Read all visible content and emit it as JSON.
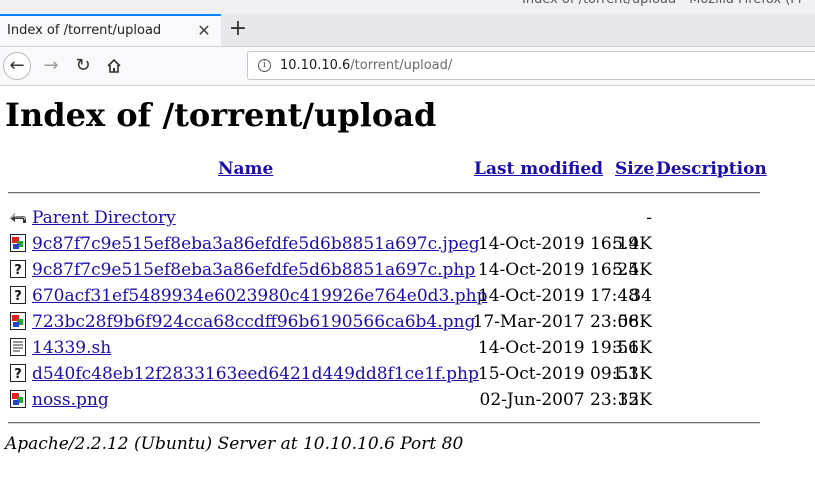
{
  "window": {
    "title": "Index of /torrent/upload - Mozilla Firefox (Pr"
  },
  "tab": {
    "title": "Index of /torrent/upload",
    "close": "✕",
    "new_tab": "+"
  },
  "navbar": {
    "url_host": "10.10.10.6",
    "url_path": "/torrent/upload/"
  },
  "page": {
    "heading": "Index of /torrent/upload",
    "columns": {
      "name": "Name",
      "modified": "Last modified",
      "size": "Size",
      "description": "Description"
    },
    "rows": [
      {
        "icon": "parent-directory-icon",
        "name": "Parent Directory",
        "modified": "",
        "size": "-"
      },
      {
        "icon": "image-file-icon",
        "name": "9c87f7c9e515ef8eba3a86efdfe5d6b8851a697c.jpeg",
        "modified": "14-Oct-2019 16:19",
        "size": "5.4K"
      },
      {
        "icon": "unknown-file-icon",
        "name": "9c87f7c9e515ef8eba3a86efdfe5d6b8851a697c.php",
        "modified": "14-Oct-2019 16:25",
        "size": "5.4K"
      },
      {
        "icon": "unknown-file-icon",
        "name": "670acf31ef5489934e6023980c419926e764e0d3.php",
        "modified": "14-Oct-2019 17:48",
        "size": "34"
      },
      {
        "icon": "image-file-icon",
        "name": "723bc28f9b6f924cca68ccdff96b6190566ca6b4.png",
        "modified": "17-Mar-2017 23:06",
        "size": "58K"
      },
      {
        "icon": "text-file-icon",
        "name": "14339.sh",
        "modified": "14-Oct-2019 19:56",
        "size": "3.1K"
      },
      {
        "icon": "unknown-file-icon",
        "name": "d540fc48eb12f2833163eed6421d449dd8f1ce1f.php",
        "modified": "15-Oct-2019 09:53",
        "size": "1.1K"
      },
      {
        "icon": "image-file-icon",
        "name": "noss.png",
        "modified": "02-Jun-2007 23:15",
        "size": "32K"
      }
    ],
    "footer": "Apache/2.2.12 (Ubuntu) Server at 10.10.10.6 Port 80"
  },
  "colors": {
    "link": "#1a0dab",
    "tab_accent": "#0a84ff"
  }
}
